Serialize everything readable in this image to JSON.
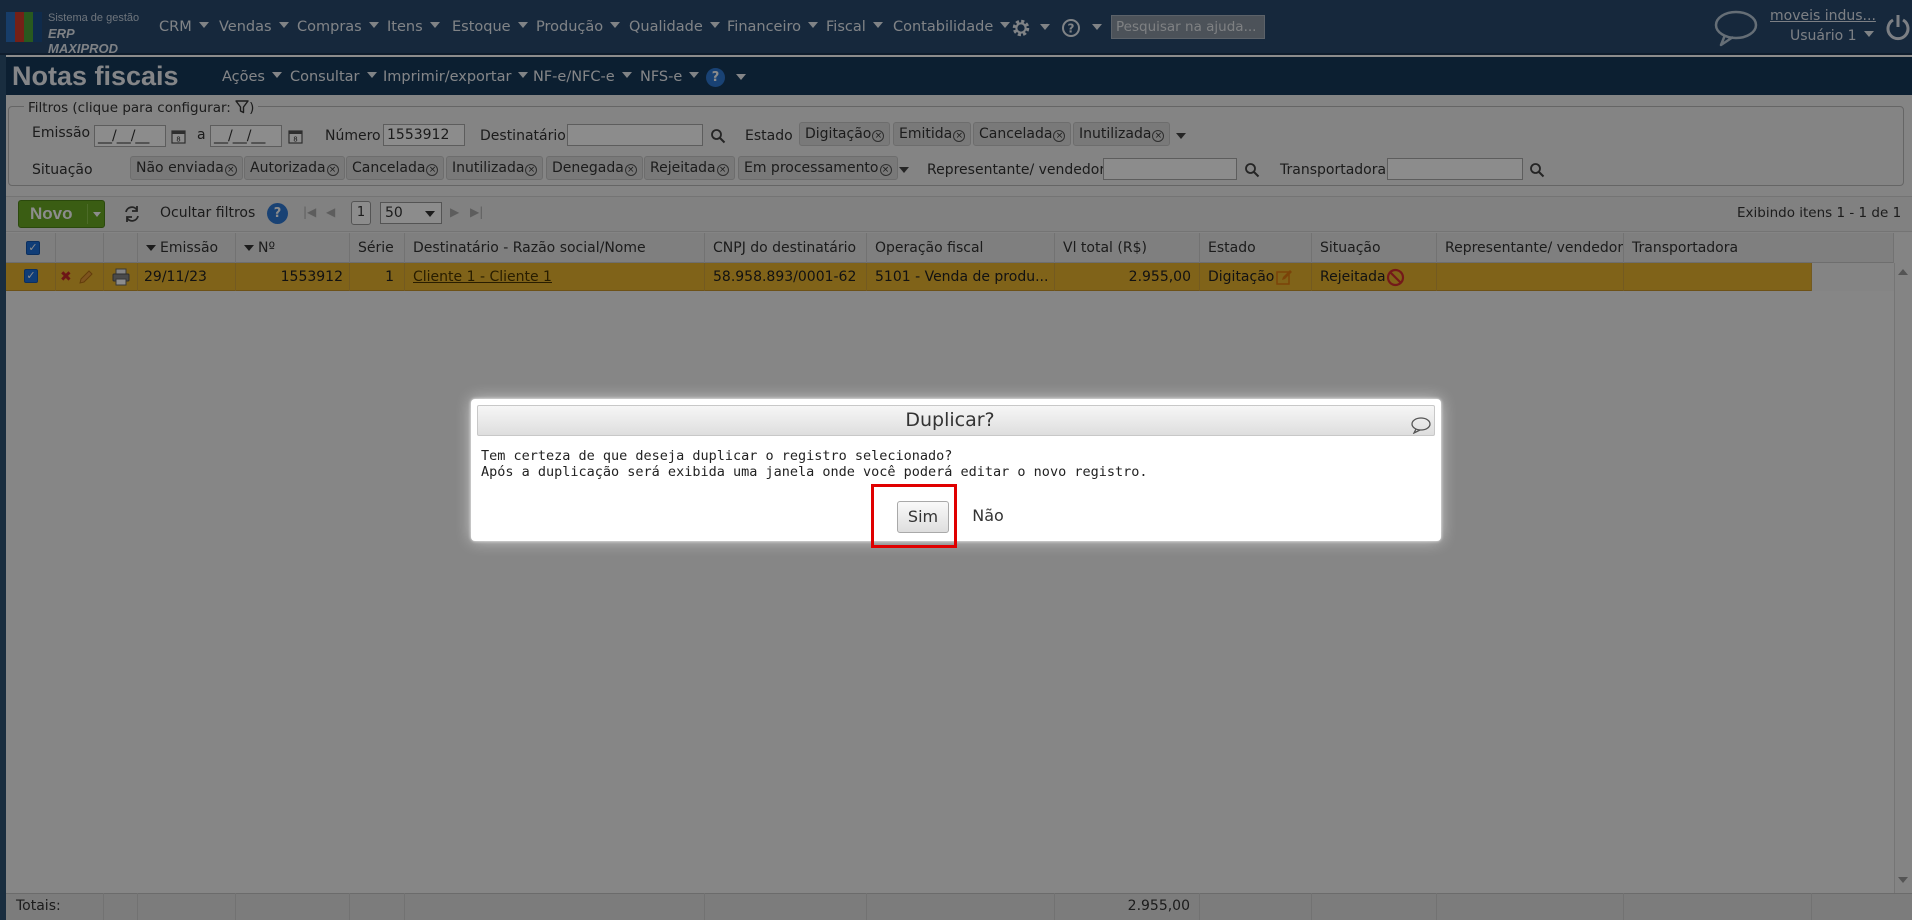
{
  "app": {
    "logo_line1": "Sistema de gestão",
    "logo_line2": "ERP MAXIPROD",
    "menu": [
      {
        "label": "CRM"
      },
      {
        "label": "Vendas"
      },
      {
        "label": "Compras"
      },
      {
        "label": "Itens"
      },
      {
        "label": "Estoque"
      },
      {
        "label": "Produção"
      },
      {
        "label": "Qualidade"
      },
      {
        "label": "Financeiro"
      },
      {
        "label": "Fiscal"
      },
      {
        "label": "Contabilidade"
      }
    ],
    "help_search_placeholder": "Pesquisar na ajuda...",
    "company_link": "moveis indus...",
    "user_menu": "Usuário 1"
  },
  "page": {
    "title": "Notas fiscais",
    "title_menu": [
      {
        "label": "Ações"
      },
      {
        "label": "Consultar"
      },
      {
        "label": "Imprimir/exportar"
      },
      {
        "label": "NF-e/NFC-e"
      },
      {
        "label": "NFS-e"
      }
    ],
    "help_label": "?"
  },
  "filters": {
    "legend": "Filtros (clique para configurar:",
    "legend_end": ")",
    "emissao_label": "Emissão",
    "date_from": "__/__/__",
    "date_sep": "a",
    "date_to": "__/__/__",
    "numero_label": "Número",
    "numero_value": "1553912",
    "destinatario_label": "Destinatário",
    "destinatario_value": "",
    "estado_label": "Estado",
    "estado_tags": [
      "Digitação",
      "Emitida",
      "Cancelada",
      "Inutilizada"
    ],
    "situacao_label": "Situação",
    "situacao_tags": [
      "Não enviada",
      "Autorizada",
      "Cancelada",
      "Inutilizada",
      "Denegada",
      "Rejeitada",
      "Em processamento"
    ],
    "representante_label": "Representante/ vendedor",
    "representante_value": "",
    "transportadora_label": "Transportadora",
    "transportadora_value": ""
  },
  "toolbar": {
    "new_label": "Novo",
    "hide_filters_label": "Ocultar filtros",
    "page_number": "1",
    "per_page": "50",
    "showing": "Exibindo itens 1 - 1 de 1"
  },
  "grid": {
    "columns": [
      "Emissão",
      "Nº",
      "Série",
      "Destinatário - Razão social/Nome",
      "CNPJ do destinatário",
      "Operação fiscal",
      "Vl total (R$)",
      "Estado",
      "Situação",
      "Representante/ vendedor",
      "Transportadora"
    ],
    "rows": [
      {
        "emissao": "29/11/23",
        "numero": "1553912",
        "serie": "1",
        "destinatario": "Cliente 1 - Cliente 1",
        "cnpj": "58.958.893/0001-62",
        "operacao": "5101 - Venda de produ...",
        "valor": "2.955,00",
        "estado": "Digitação",
        "situacao": "Rejeitada",
        "representante": "",
        "transportadora": ""
      }
    ],
    "totals_label": "Totais:",
    "totals_value": "2.955,00"
  },
  "dialog": {
    "title": "Duplicar?",
    "line1": "Tem certeza de que deseja duplicar o registro selecionado?",
    "line2": "Após a duplicação será exibida uma janela onde você poderá editar o novo registro.",
    "yes_label": "Sim",
    "no_label": "Não"
  },
  "colors": {
    "topbar": "#284a6e",
    "titlebar": "#173a59",
    "new_button": "#6aaa24",
    "selected_row": "#e9b52f",
    "highlight_box": "#e00000"
  }
}
